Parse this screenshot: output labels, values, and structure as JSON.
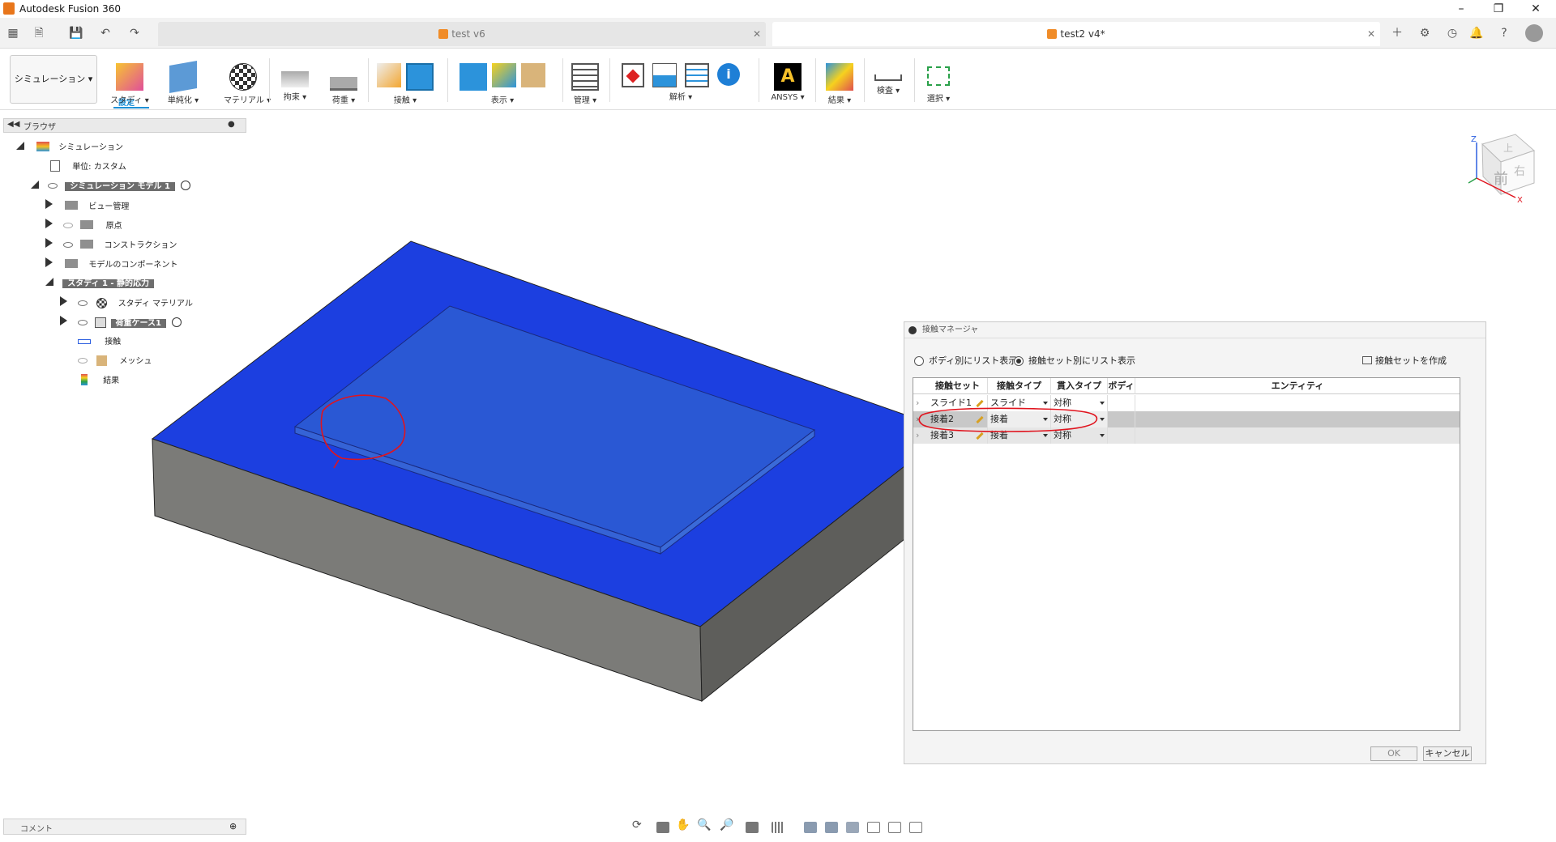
{
  "app": {
    "title": "Autodesk Fusion 360"
  },
  "tabs": [
    {
      "label": "test v6"
    },
    {
      "label": "test2 v4*"
    }
  ],
  "ribbon": {
    "mode_label": "シミュレーション",
    "active_tab": "設定",
    "groups": [
      {
        "label": "スタディ"
      },
      {
        "label": "単純化"
      },
      {
        "label": "マテリアル"
      },
      {
        "label": "拘束"
      },
      {
        "label": "荷重"
      },
      {
        "label": "接触"
      },
      {
        "label": "表示"
      },
      {
        "label": "管理"
      },
      {
        "label": "解析"
      },
      {
        "label": "ANSYS"
      },
      {
        "label": "結果"
      },
      {
        "label": "検査"
      },
      {
        "label": "選択"
      }
    ]
  },
  "browser": {
    "title": "ブラウザ",
    "nodes": [
      {
        "label": "シミュレーション"
      },
      {
        "label": "単位: カスタム"
      },
      {
        "label": "シミュレーション モデル 1"
      },
      {
        "label": "ビュー管理"
      },
      {
        "label": "原点"
      },
      {
        "label": "コンストラクション"
      },
      {
        "label": "モデルのコンポーネント"
      },
      {
        "label": "スタディ 1 - 静的応力"
      },
      {
        "label": "スタディ マテリアル"
      },
      {
        "label": "荷重ケース1"
      },
      {
        "label": "接触"
      },
      {
        "label": "メッシュ"
      },
      {
        "label": "結果"
      }
    ]
  },
  "viewcube": {
    "front": "前",
    "right": "右",
    "top": "上",
    "axis_z": "Z",
    "axis_x": "X"
  },
  "dialog": {
    "title": "接触マネージャ",
    "radio_body": "ボディ別にリスト表示",
    "radio_set": "接触セット別にリスト表示",
    "create_btn": "接触セットを作成",
    "columns": [
      "接触セット",
      "接触タイプ",
      "貫入タイプ",
      "ボディ",
      "エンティティ"
    ],
    "rows": [
      {
        "set": "スライド1",
        "type": "スライド",
        "pen": "対称"
      },
      {
        "set": "接着2",
        "type": "接着",
        "pen": "対称"
      },
      {
        "set": "接着3",
        "type": "接着",
        "pen": "対称"
      }
    ],
    "ok": "OK",
    "cancel": "キャンセル"
  },
  "comment": {
    "label": "コメント"
  },
  "colors": {
    "accent": "#1e90d6",
    "model_top": "#1c3fe0",
    "annotation": "#e0141e"
  }
}
